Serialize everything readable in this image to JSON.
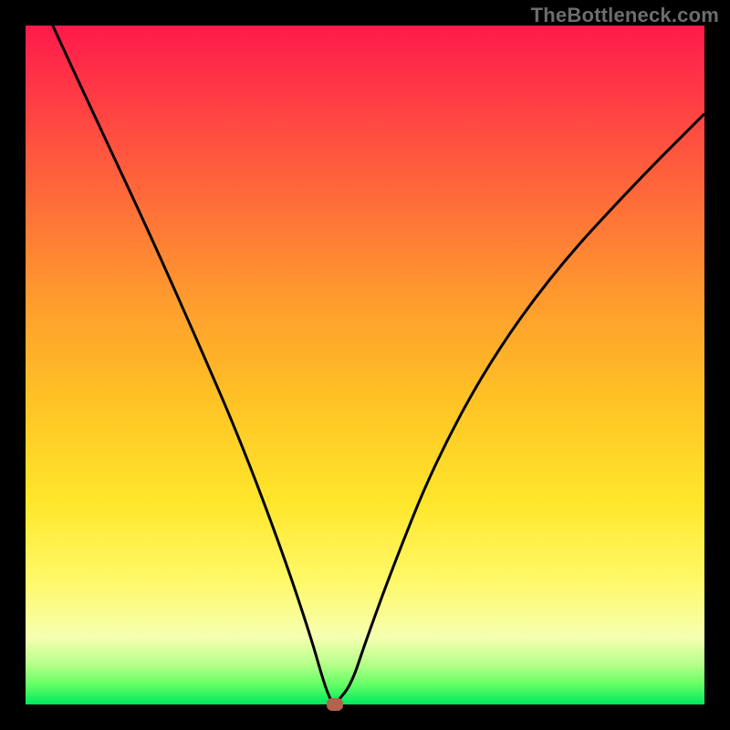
{
  "watermark": "TheBottleneck.com",
  "chart_data": {
    "type": "line",
    "title": "",
    "xlabel": "",
    "ylabel": "",
    "xlim": [
      0,
      100
    ],
    "ylim": [
      0,
      100
    ],
    "grid": false,
    "legend": false,
    "series": [
      {
        "name": "curve",
        "x": [
          4,
          10,
          18,
          26,
          32,
          38,
          42,
          44,
          45,
          45.5,
          46,
          48,
          50,
          54,
          60,
          68,
          78,
          90,
          100
        ],
        "y": [
          100,
          87,
          70,
          52,
          38,
          22,
          10,
          3,
          0.5,
          0,
          0.5,
          3,
          9,
          20,
          35,
          50,
          64,
          77,
          87
        ]
      }
    ],
    "marker": {
      "x": 45.5,
      "y": 0
    },
    "colors": {
      "curve": "#000000",
      "marker": "#b3624e",
      "gradient_top": "#ff1a4b",
      "gradient_bottom": "#00e85e",
      "frame": "#000000"
    }
  }
}
